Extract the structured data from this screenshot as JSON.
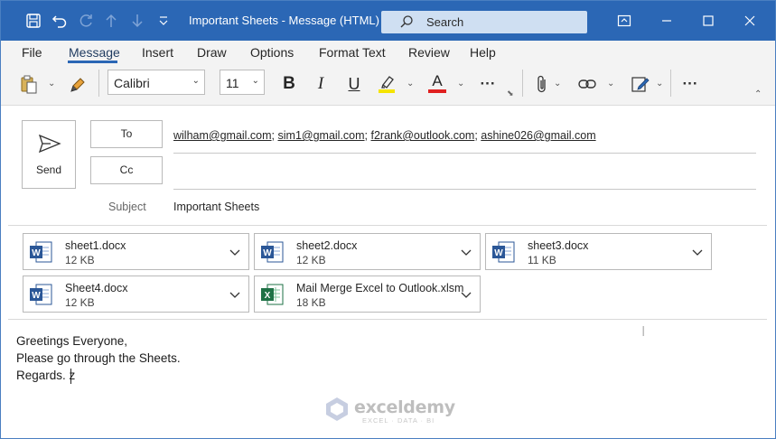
{
  "window": {
    "title": "Important Sheets  -  Message (HTML)",
    "search_label": "Search"
  },
  "menu": {
    "tabs": [
      "File",
      "Message",
      "Insert",
      "Draw",
      "Options",
      "Format Text",
      "Review",
      "Help"
    ],
    "active": "Message"
  },
  "ribbon": {
    "font_name": "Calibri",
    "font_size": "11",
    "bold": "B",
    "italic": "I",
    "underline": "U",
    "font_color_label": "A",
    "highlight_color": "#f5e400",
    "font_color": "#e02020",
    "more": "···"
  },
  "header": {
    "send_label": "Send",
    "to_label": "To",
    "cc_label": "Cc",
    "to_recipients": [
      "wilham@gmail.com",
      "sim1@gmail.com",
      "f2rank@outlook.com",
      "ashine026@gmail.com"
    ],
    "cc_value": "",
    "subject_label": "Subject",
    "subject_value": "Important Sheets"
  },
  "attachments": [
    {
      "name": "sheet1.docx",
      "size": "12 KB",
      "type": "word-icon"
    },
    {
      "name": "sheet2.docx",
      "size": "12 KB",
      "type": "word-icon"
    },
    {
      "name": "sheet3.docx",
      "size": "11 KB",
      "type": "word-icon"
    },
    {
      "name": "Sheet4.docx",
      "size": "12 KB",
      "type": "word-icon"
    },
    {
      "name": "Mail Merge Excel to Outlook.xlsm",
      "size": "18 KB",
      "type": "excel-icon"
    }
  ],
  "body": {
    "lines": [
      "Greetings Everyone,",
      "Please go through the Sheets.",
      "Regards. z"
    ]
  },
  "watermark": {
    "name": "exceldemy",
    "tagline": "EXCEL · DATA · BI"
  },
  "colors": {
    "titlebar": "#2b67b5",
    "word": "#2b5797",
    "excel": "#1e7145"
  }
}
